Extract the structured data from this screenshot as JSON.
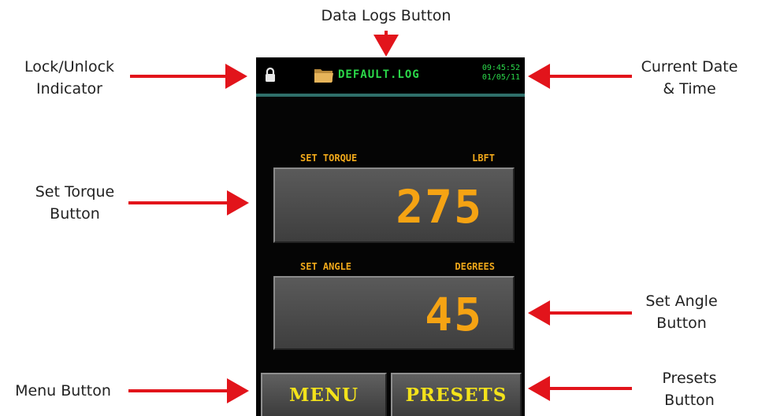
{
  "callouts": {
    "data_logs": "Data Logs Button",
    "lock_line1": "Lock/Unlock",
    "lock_line2": "Indicator",
    "datetime_line1": "Current Date",
    "datetime_line2": "& Time",
    "torque_line1": "Set Torque",
    "torque_line2": "Button",
    "angle_line1": "Set Angle",
    "angle_line2": "Button",
    "menu": "Menu Button",
    "presets_line1": "Presets",
    "presets_line2": "Button"
  },
  "device": {
    "status": {
      "log_name": "DEFAULT.LOG",
      "time": "09:45:52",
      "date": "01/05/11"
    },
    "torque": {
      "label": "SET TORQUE",
      "unit": "LBFT",
      "value": "275"
    },
    "angle": {
      "label": "SET ANGLE",
      "unit": "DEGREES",
      "value": "45"
    },
    "buttons": {
      "menu": "MENU",
      "presets": "PRESETS"
    }
  },
  "colors": {
    "arrow": "#e2141b",
    "screen_text_green": "#2bd94a",
    "value_orange": "#f5a313",
    "button_text_yellow": "#f3e21b"
  },
  "icons": {
    "lock": "lock-icon",
    "folder": "folder-icon"
  }
}
